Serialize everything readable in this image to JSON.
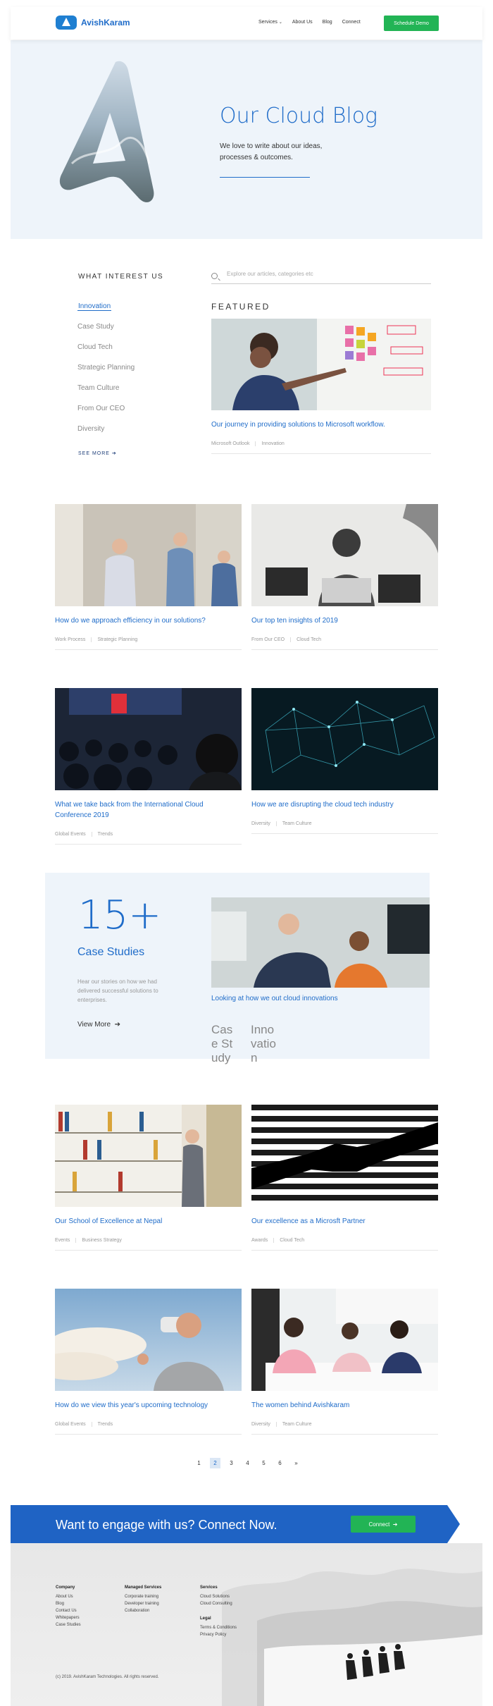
{
  "header": {
    "brand": "AvishKaram",
    "nav": [
      "Services",
      "About Us",
      "Blog",
      "Connect"
    ],
    "cta": "Schedule Demo"
  },
  "hero": {
    "title": "Our Cloud Blog",
    "subtitle": "We love to write about our ideas, processes & outcomes."
  },
  "interests": {
    "title": "WHAT INTEREST US",
    "categories": [
      "Innovation",
      "Case Study",
      "Cloud Tech",
      "Strategic Planning",
      "Team Culture",
      "From Our CEO",
      "Diversity"
    ],
    "see_more": "SEE MORE"
  },
  "search": {
    "placeholder": "Explore our articles, categories etc"
  },
  "featured": {
    "label": "FEATURED",
    "title": "Our journey in providing solutions to Microsoft workflow.",
    "tags": [
      "Microsoft Outlook",
      "Innovation"
    ]
  },
  "posts": [
    {
      "title": "How do we approach efficiency in our solutions?",
      "tags": [
        "Work Process",
        "Strategic Planning"
      ]
    },
    {
      "title": "Our top ten insights of 2019",
      "tags": [
        "From Our CEO",
        "Cloud Tech"
      ]
    },
    {
      "title": "What we take back from the International Cloud Conference 2019",
      "tags": [
        "Global Events",
        "Trends"
      ]
    },
    {
      "title": "How we are disrupting the cloud tech industry",
      "tags": [
        "Diversity",
        "Team Culture"
      ]
    },
    {
      "title": "Our School of Excellence at Nepal",
      "tags": [
        "Events",
        "Business Strategy"
      ]
    },
    {
      "title": "Our excellence as a Microsft Partner",
      "tags": [
        "Awards",
        "Cloud Tech"
      ]
    },
    {
      "title": "How do we view this year's upcoming technology",
      "tags": [
        "Global Events",
        "Trends"
      ]
    },
    {
      "title": "The women behind Avishkaram",
      "tags": [
        "Diversity",
        "Team Culture"
      ]
    }
  ],
  "case_studies": {
    "number": "15+",
    "label": "Case Studies",
    "description": "Hear our stories on how we had delivered successful solutions to enterprises.",
    "view_more": "View More",
    "card_title": "Looking at how we out cloud innovations",
    "tags": [
      "Case Study",
      "Innovation"
    ]
  },
  "pagination": {
    "pages": [
      "1",
      "2",
      "3",
      "4",
      "5",
      "6"
    ],
    "next": "»",
    "current": "2"
  },
  "cta": {
    "text": "Want to engage with us? Connect Now.",
    "button": "Connect"
  },
  "footer": {
    "company": {
      "heading": "Company",
      "links": [
        "About Us",
        "Blog",
        "Contact Us",
        "Whitepapers",
        "Case Studies"
      ]
    },
    "managed": {
      "heading": "Managed Services",
      "links": [
        "Corporate training",
        "Developer training",
        "Collaboration"
      ]
    },
    "services": {
      "heading": "Services",
      "links": [
        "Cloud Solutions",
        "Cloud Consulting"
      ]
    },
    "legal": {
      "heading": "Legal",
      "links": [
        "Terms & Conditions",
        "Privacy Policy"
      ]
    },
    "copyright": "(c) 2019. AvishKaram Technologies. All rights reserved."
  },
  "colors": {
    "accent": "#1f6cc9",
    "cta_green": "#22b455",
    "hero_bg": "#eef4fa",
    "banner": "#1f63c4"
  }
}
